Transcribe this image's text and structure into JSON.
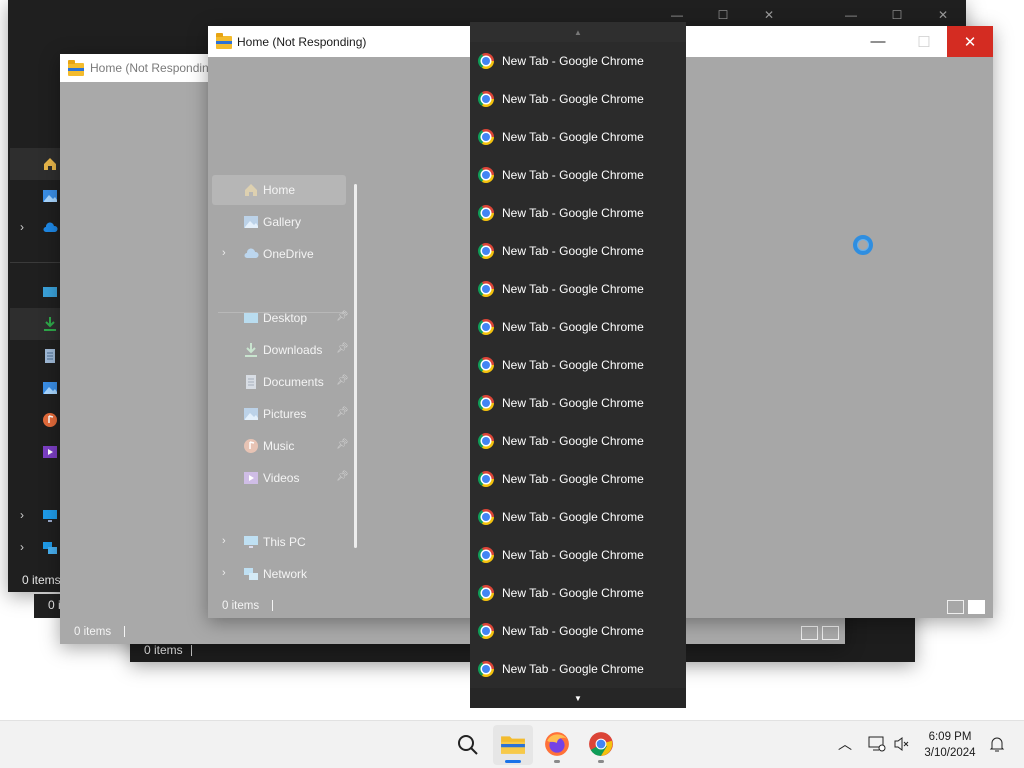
{
  "front_window": {
    "title": "Home (Not Responding)",
    "status": "0 items",
    "caption": {
      "minimize": "—",
      "maximize": "☐",
      "close": "✕"
    },
    "nav": [
      {
        "label": "Home",
        "icon": "home-icon",
        "selected": true,
        "pinned": false,
        "expandable": false
      },
      {
        "label": "Gallery",
        "icon": "gallery-icon",
        "selected": false,
        "pinned": false,
        "expandable": false
      },
      {
        "label": "OneDrive",
        "icon": "cloud-icon",
        "selected": false,
        "pinned": false,
        "expandable": true
      },
      {
        "label": "Desktop",
        "icon": "desktop-folder-icon",
        "selected": false,
        "pinned": true,
        "expandable": false
      },
      {
        "label": "Downloads",
        "icon": "download-icon",
        "selected": false,
        "pinned": true,
        "expandable": false
      },
      {
        "label": "Documents",
        "icon": "documents-icon",
        "selected": false,
        "pinned": true,
        "expandable": false
      },
      {
        "label": "Pictures",
        "icon": "pictures-icon",
        "selected": false,
        "pinned": true,
        "expandable": false
      },
      {
        "label": "Music",
        "icon": "music-icon",
        "selected": false,
        "pinned": true,
        "expandable": false
      },
      {
        "label": "Videos",
        "icon": "videos-icon",
        "selected": false,
        "pinned": true,
        "expandable": false
      },
      {
        "label": "This PC",
        "icon": "pc-icon",
        "selected": false,
        "pinned": false,
        "expandable": true
      },
      {
        "label": "Network",
        "icon": "network-icon",
        "selected": false,
        "pinned": false,
        "expandable": true
      }
    ]
  },
  "middle_window": {
    "title": "Home (Not Respondin",
    "status": "0 items"
  },
  "back_window_b": {
    "status": "0 items"
  },
  "back_window_a": {
    "status": "0 items"
  },
  "back_window_c": {
    "status": "0 i"
  },
  "jumplist": {
    "items": [
      "New Tab - Google Chrome",
      "New Tab - Google Chrome",
      "New Tab - Google Chrome",
      "New Tab - Google Chrome",
      "New Tab - Google Chrome",
      "New Tab - Google Chrome",
      "New Tab - Google Chrome",
      "New Tab - Google Chrome",
      "New Tab - Google Chrome",
      "New Tab - Google Chrome",
      "New Tab - Google Chrome",
      "New Tab - Google Chrome",
      "New Tab - Google Chrome",
      "New Tab - Google Chrome",
      "New Tab - Google Chrome",
      "New Tab - Google Chrome",
      "New Tab - Google Chrome"
    ],
    "scroll_up": "▲",
    "scroll_down": "▼"
  },
  "taskbar": {
    "apps": [
      {
        "name": "search",
        "icon": "search-icon"
      },
      {
        "name": "file-explorer",
        "icon": "file-explorer-icon",
        "active": true
      },
      {
        "name": "firefox",
        "icon": "firefox-icon"
      },
      {
        "name": "chrome",
        "icon": "chrome-icon"
      }
    ],
    "time": "6:09 PM",
    "date": "3/10/2024"
  },
  "colors": {
    "close_red": "#d42c22",
    "accent_blue": "#1a73e8",
    "jumplist_bg": "#2b2b2b"
  }
}
